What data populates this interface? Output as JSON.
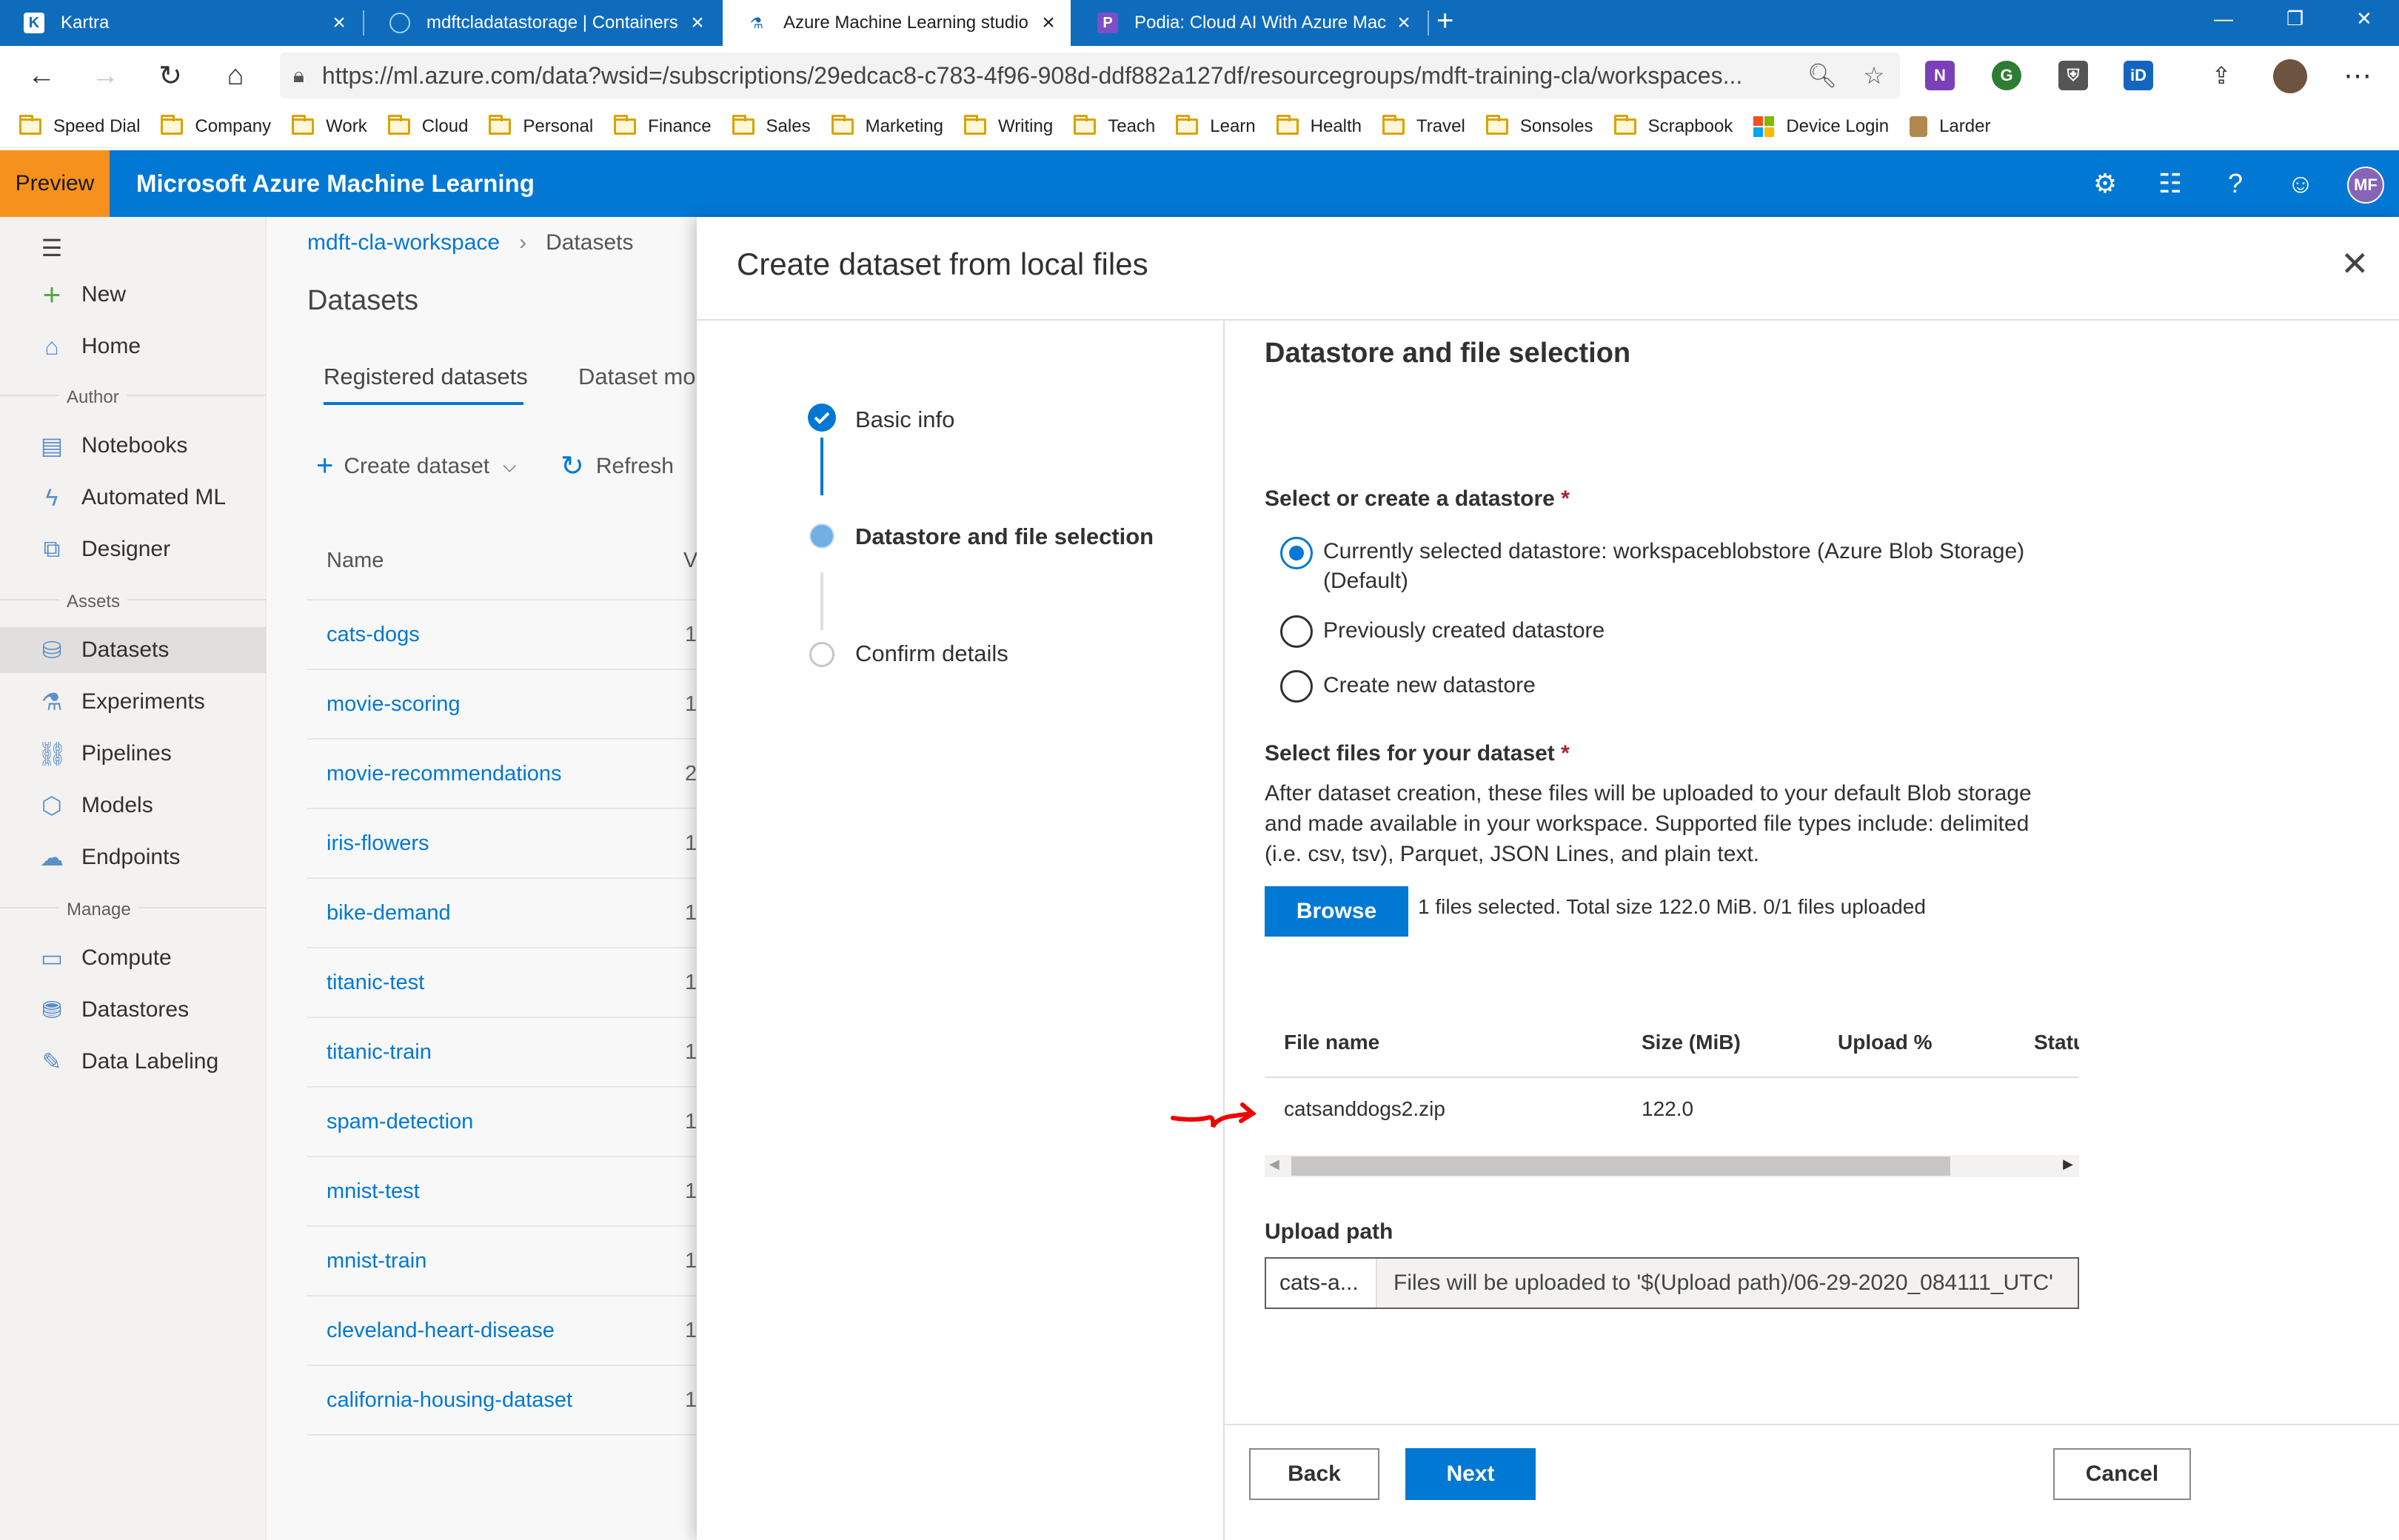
{
  "browser": {
    "tabs": [
      {
        "title": "Kartra",
        "active": false
      },
      {
        "title": "mdftcladatastorage | Containers",
        "active": false
      },
      {
        "title": "Azure Machine Learning studio (",
        "active": true
      },
      {
        "title": "Podia: Cloud AI With Azure Mac",
        "active": false
      }
    ],
    "address": "https://ml.azure.com/data?wsid=/subscriptions/29edcac8-c783-4f96-908d-ddf882a127df/resourcegroups/mdft-training-cla/workspaces...",
    "favorites": [
      "Speed Dial",
      "Company",
      "Work",
      "Cloud",
      "Personal",
      "Finance",
      "Sales",
      "Marketing",
      "Writing",
      "Teach",
      "Learn",
      "Health",
      "Travel",
      "Sonsoles",
      "Scrapbook",
      "Device Login",
      "Larder"
    ],
    "accent_color": "#0f6cbd"
  },
  "header": {
    "preview_label": "Preview",
    "app_title": "Microsoft Azure Machine Learning",
    "user_initials": "MF",
    "accent_color": "#0078d4"
  },
  "leftnav": {
    "top_items": [
      "New",
      "Home"
    ],
    "sections": [
      {
        "title": "Author",
        "items": [
          "Notebooks",
          "Automated ML",
          "Designer"
        ]
      },
      {
        "title": "Assets",
        "items": [
          "Datasets",
          "Experiments",
          "Pipelines",
          "Models",
          "Endpoints"
        ]
      },
      {
        "title": "Manage",
        "items": [
          "Compute",
          "Datastores",
          "Data Labeling"
        ]
      }
    ],
    "selected": "Datasets"
  },
  "datasets_page": {
    "breadcrumb": [
      "mdft-cla-workspace",
      "Datasets"
    ],
    "title": "Datasets",
    "tabs": [
      "Registered datasets",
      "Dataset mo"
    ],
    "create_label": "Create dataset",
    "refresh_label": "Refresh",
    "col_name": "Name",
    "col_version": "V",
    "rows": [
      {
        "name": "cats-dogs",
        "v": "1"
      },
      {
        "name": "movie-scoring",
        "v": "1"
      },
      {
        "name": "movie-recommendations",
        "v": "2"
      },
      {
        "name": "iris-flowers",
        "v": "1"
      },
      {
        "name": "bike-demand",
        "v": "1"
      },
      {
        "name": "titanic-test",
        "v": "1"
      },
      {
        "name": "titanic-train",
        "v": "1"
      },
      {
        "name": "spam-detection",
        "v": "1"
      },
      {
        "name": "mnist-test",
        "v": "1"
      },
      {
        "name": "mnist-train",
        "v": "1"
      },
      {
        "name": "cleveland-heart-disease",
        "v": "1"
      },
      {
        "name": "california-housing-dataset",
        "v": "1"
      }
    ]
  },
  "panel": {
    "title": "Create dataset from local files",
    "steps": [
      {
        "label": "Basic info",
        "state": "done"
      },
      {
        "label": "Datastore and file selection",
        "state": "current"
      },
      {
        "label": "Confirm details",
        "state": "pending"
      }
    ],
    "section_title": "Datastore and file selection",
    "datastore_label": "Select or create a datastore",
    "required_mark": "*",
    "radio_options": [
      {
        "label_line1": "Currently selected datastore: workspaceblobstore (Azure Blob Storage)",
        "label_line2": "(Default)",
        "selected": true
      },
      {
        "label_line1": "Previously created datastore",
        "label_line2": "",
        "selected": false
      },
      {
        "label_line1": "Create new datastore",
        "label_line2": "",
        "selected": false
      }
    ],
    "files_label": "Select files for your dataset",
    "files_description": "After dataset creation, these files will be uploaded to your default Blob storage and made available in your workspace. Supported file types include: delimited (i.e. csv, tsv), Parquet, JSON Lines, and plain text.",
    "browse_label": "Browse",
    "files_status": "1 files selected. Total size 122.0 MiB. 0/1 files uploaded",
    "table": {
      "columns": [
        "File name",
        "Size (MiB)",
        "Upload %",
        "Statu"
      ],
      "rows": [
        {
          "file": "catsanddogs2.zip",
          "size": "122.0",
          "upload": "",
          "status": ""
        }
      ]
    },
    "upload_path_label": "Upload path",
    "upload_path_value": "cats-a...",
    "upload_path_suffix": "Files will be uploaded to '$(Upload path)/06-29-2020_084111_UTC'",
    "buttons": {
      "back": "Back",
      "next": "Next",
      "cancel": "Cancel"
    }
  }
}
